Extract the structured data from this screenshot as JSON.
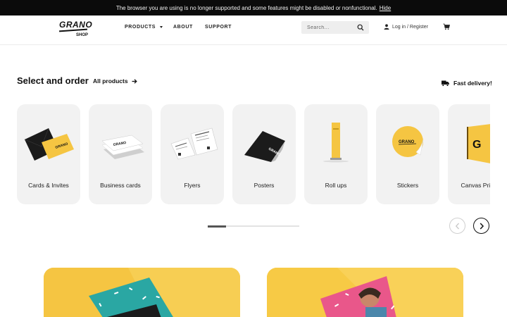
{
  "banner": {
    "message": "The browser you are using is no longer supported and some features might be disabled or nonfunctional.",
    "hide_label": "Hide"
  },
  "header": {
    "logo": {
      "text": "GRANO",
      "sub": "SHOP"
    },
    "nav": [
      {
        "label": "PRODUCTS"
      },
      {
        "label": "ABOUT"
      },
      {
        "label": "SUPPORT"
      }
    ],
    "search": {
      "placeholder": "Search...",
      "value": ""
    },
    "login_label": "Log in / Register",
    "icons": {
      "search": "search-icon",
      "user": "user-icon",
      "cart": "cart-icon"
    }
  },
  "products_section": {
    "title": "Select and order",
    "all_products_label": "All products",
    "fast_delivery_label": "Fast delivery!",
    "items": [
      {
        "label": "Cards & Invites"
      },
      {
        "label": "Business cards"
      },
      {
        "label": "Flyers"
      },
      {
        "label": "Posters"
      },
      {
        "label": "Roll ups"
      },
      {
        "label": "Stickers"
      },
      {
        "label": "Canvas Prints"
      }
    ]
  },
  "colors": {
    "accent": "#f5c542",
    "banner_bg": "#0b0b0b",
    "card_bg": "#f2f2f2",
    "promo_pink": "#e9578a",
    "promo_teal": "#2aa7a3"
  }
}
